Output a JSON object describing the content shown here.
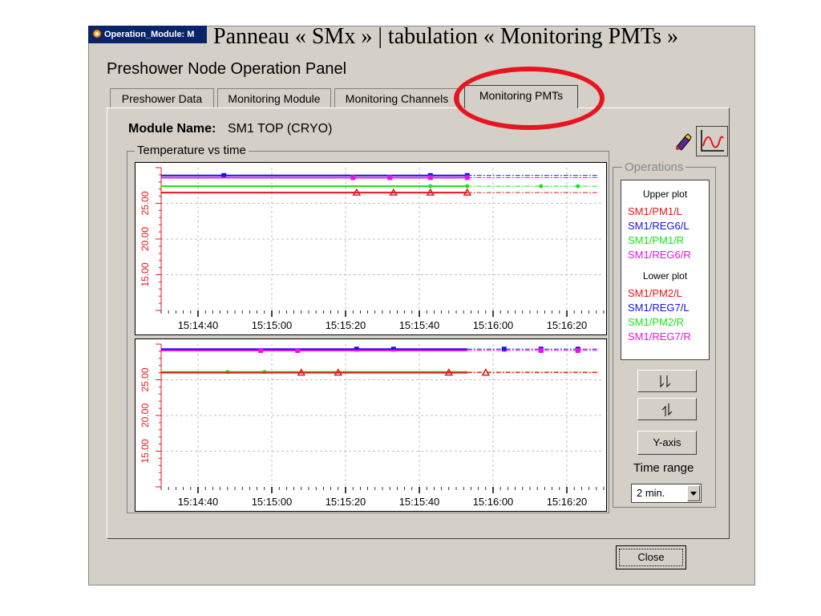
{
  "caption": "Panneau « SMx » | tabulation « Monitoring PMTs »",
  "window": {
    "title": "Operation_Module: M",
    "panel_title": "Preshower Node Operation Panel"
  },
  "tabs": [
    {
      "label": "Preshower Data"
    },
    {
      "label": "Monitoring Module"
    },
    {
      "label": "Monitoring Channels"
    },
    {
      "label": "Monitoring PMTs",
      "active": true
    }
  ],
  "module": {
    "name_label": "Module Name:",
    "name_value": "SM1  TOP (CRYO)"
  },
  "group_title": "Temperature vs time",
  "operations": {
    "title": "Operations",
    "upper_header": "Upper plot",
    "upper_items": [
      {
        "label": "SM1/PM1/L",
        "color": "#e8141e"
      },
      {
        "label": "SM1/REG6/L",
        "color": "#1414e6"
      },
      {
        "label": "SM1/PM1/R",
        "color": "#14e614"
      },
      {
        "label": "SM1/REG6/R",
        "color": "#e614e6"
      }
    ],
    "lower_header": "Lower plot",
    "lower_items": [
      {
        "label": "SM1/PM2/L",
        "color": "#e8141e"
      },
      {
        "label": "SM1/REG7/L",
        "color": "#1414e6"
      },
      {
        "label": "SM1/PM2/R",
        "color": "#14e614"
      },
      {
        "label": "SM1/REG7/R",
        "color": "#e614e6"
      }
    ],
    "zoom_in_icon": "zoom-in-icon",
    "zoom_out_icon": "zoom-out-icon",
    "yaxis_label": "Y-axis",
    "time_range_label": "Time range",
    "time_range_value": "2 min."
  },
  "close_label": "Close",
  "chart_data": [
    {
      "type": "line",
      "name": "Upper plot",
      "x_ticks": [
        "15:14:40",
        "15:15:00",
        "15:15:20",
        "15:15:40",
        "15:16:00",
        "15:16:20"
      ],
      "y_ticks": [
        "25.00",
        "20.00",
        "15.00"
      ],
      "ylim": [
        10,
        30
      ],
      "series": [
        {
          "name": "SM1/REG6/L",
          "color": "#1414e6",
          "value": 28.9,
          "marker": "square",
          "marker_times": [
            "15:14:47",
            "15:15:43",
            "15:15:53"
          ]
        },
        {
          "name": "SM1/REG6/R",
          "color": "#e614e6",
          "value": 28.6,
          "marker": "square",
          "marker_times": [
            "15:15:22",
            "15:15:32",
            "15:15:43",
            "15:15:53"
          ]
        },
        {
          "name": "SM1/PM1/R",
          "color": "#14e614",
          "value": 27.4,
          "marker": "circle",
          "marker_times": [
            "15:15:43",
            "15:15:53",
            "15:16:13",
            "15:16:23"
          ]
        },
        {
          "name": "SM1/PM1/L",
          "color": "#e8141e",
          "value": 26.5,
          "marker": "triangle",
          "marker_times": [
            "15:15:23",
            "15:15:33",
            "15:15:43",
            "15:15:53"
          ]
        }
      ]
    },
    {
      "type": "line",
      "name": "Lower plot",
      "x_ticks": [
        "15:14:40",
        "15:15:00",
        "15:15:20",
        "15:15:40",
        "15:16:00",
        "15:16:20"
      ],
      "y_ticks": [
        "25.00",
        "20.00",
        "15.00"
      ],
      "ylim": [
        10,
        30
      ],
      "series": [
        {
          "name": "SM1/REG7/L",
          "color": "#1414e6",
          "value": 29.3,
          "marker": "square",
          "marker_times": [
            "15:15:23",
            "15:15:33",
            "15:16:03",
            "15:16:13",
            "15:16:23"
          ]
        },
        {
          "name": "SM1/REG7/R",
          "color": "#e614e6",
          "value": 29.1,
          "marker": "square",
          "marker_times": [
            "15:14:57",
            "15:15:07",
            "15:16:13",
            "15:16:23"
          ]
        },
        {
          "name": "SM1/PM2/R",
          "color": "#14e614",
          "value": 26.1,
          "marker": "circle",
          "marker_times": [
            "15:14:48",
            "15:14:58"
          ]
        },
        {
          "name": "SM1/PM2/L",
          "color": "#e8141e",
          "value": 26.0,
          "marker": "triangle",
          "marker_times": [
            "15:15:08",
            "15:15:18",
            "15:15:48",
            "15:15:58"
          ]
        }
      ]
    }
  ]
}
